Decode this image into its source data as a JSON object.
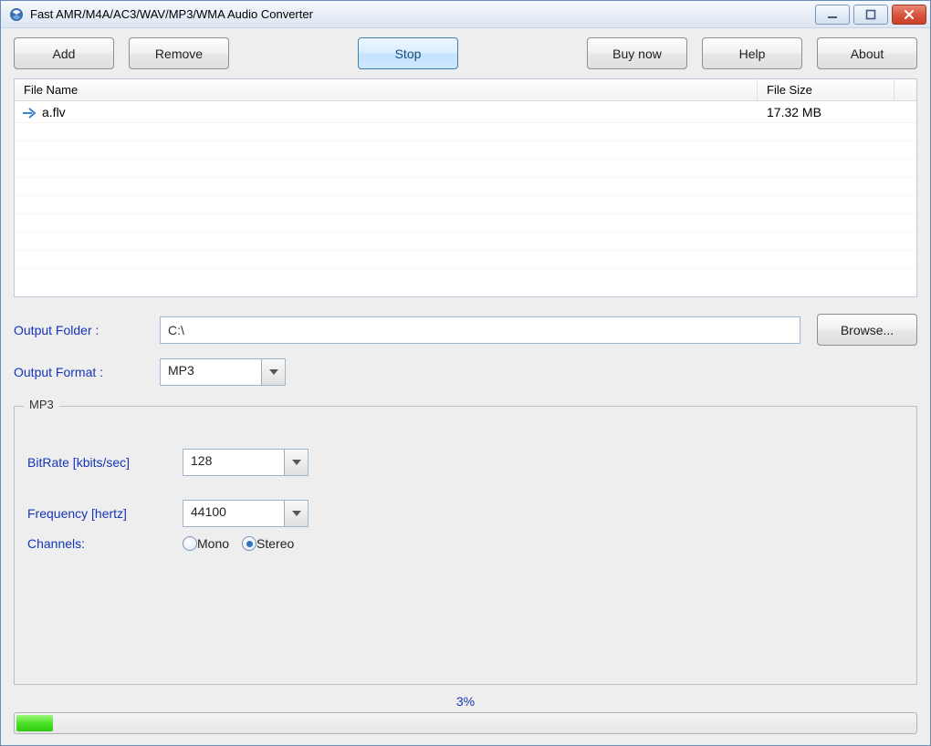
{
  "title": "Fast AMR/M4A/AC3/WAV/MP3/WMA Audio Converter",
  "toolbar": {
    "add": "Add",
    "remove": "Remove",
    "stop": "Stop",
    "buy": "Buy now",
    "help": "Help",
    "about": "About"
  },
  "filelist": {
    "header_name": "File Name",
    "header_size": "File Size",
    "rows": [
      {
        "name": "a.flv",
        "size": "17.32 MB"
      }
    ]
  },
  "output_folder_label": "Output Folder :",
  "output_folder_value": "C:\\",
  "browse_label": "Browse...",
  "output_format_label": "Output Format :",
  "output_format_value": "MP3",
  "group": {
    "title": "MP3",
    "bitrate_label": "BitRate [kbits/sec]",
    "bitrate_value": "128",
    "freq_label": "Frequency [hertz]",
    "freq_value": "44100",
    "channels_label": "Channels:",
    "mono": "Mono",
    "stereo": "Stereo",
    "channels_selected": "stereo"
  },
  "progress": {
    "text": "3%",
    "percent": 3
  }
}
